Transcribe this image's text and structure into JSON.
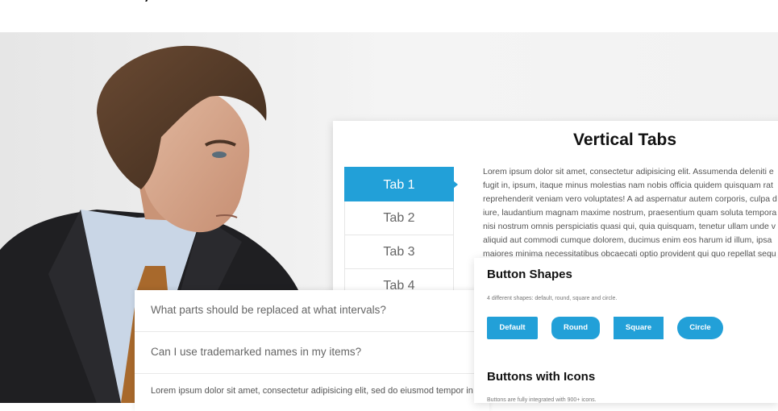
{
  "vertical_tabs": {
    "title": "Vertical Tabs",
    "tabs": [
      {
        "label": "Tab 1",
        "active": true
      },
      {
        "label": "Tab 2",
        "active": false
      },
      {
        "label": "Tab 3",
        "active": false
      },
      {
        "label": "Tab 4",
        "active": false
      }
    ],
    "content_lines": [
      "Lorem ipsum dolor sit amet, consectetur adipisicing elit. Assumenda deleniti e",
      "fugit in, ipsum, itaque minus molestias nam nobis officia quidem quisquam rat",
      "reprehenderit veniam vero voluptates! A ad aspernatur autem corporis, culpa d",
      "iure, laudantium magnam maxime nostrum, praesentium quam soluta tempora",
      "nisi nostrum omnis perspiciatis quasi qui, quia quisquam, tenetur ullam unde v",
      "aliquid aut commodi cumque dolorem, ducimus enim eos harum id illum, ipsa",
      "maiores minima necessitatibus obcaecati optio provident qui quo repellat sequ"
    ]
  },
  "faq": {
    "items": [
      "What parts should be replaced at what intervals?",
      "Can I use trademarked names in my items?"
    ],
    "body": "Lorem ipsum dolor sit amet, consectetur adipisicing elit, sed do eiusmod tempor in"
  },
  "button_shapes": {
    "title": "Button Shapes",
    "description": "4 different shapes: default, round, square and circle.",
    "buttons": [
      "Default",
      "Round",
      "Square",
      "Circle"
    ]
  },
  "buttons_with_icons": {
    "title": "Buttons with Icons",
    "description": "Buttons are fully integrated with 900+ icons."
  },
  "colors": {
    "accent": "#22a0d8",
    "hero_background": "#f3f3f3"
  }
}
